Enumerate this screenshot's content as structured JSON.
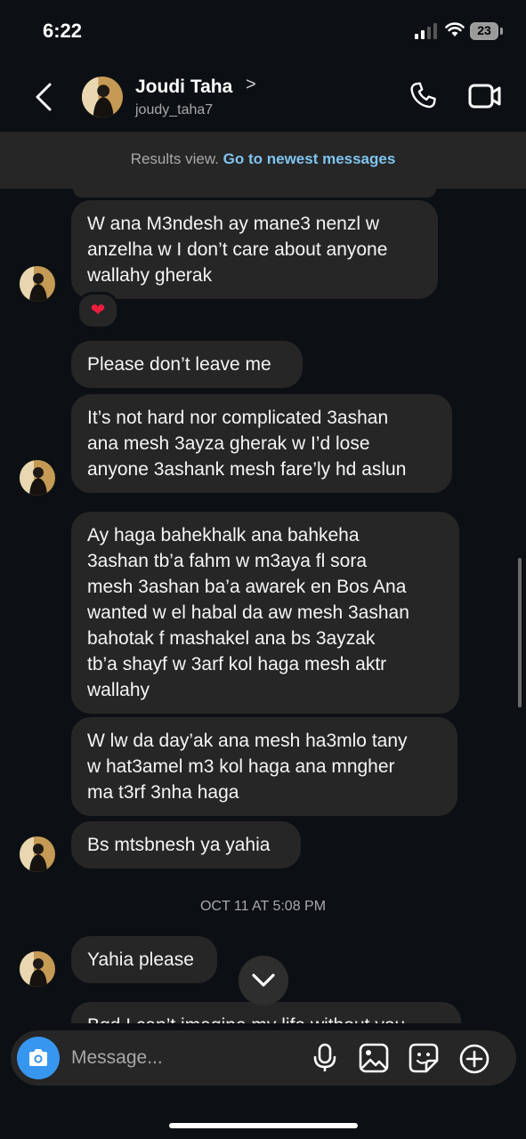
{
  "status_bar": {
    "time": "6:22",
    "battery": "23"
  },
  "header": {
    "contact_name": "Joudi Taha",
    "chevron": ">",
    "username": "joudy_taha7",
    "icons": [
      "back-icon",
      "phone-icon",
      "video-icon"
    ]
  },
  "banner": {
    "prefix": "Results view.",
    "link": "Go to newest messages"
  },
  "messages": [
    {
      "text": "W ana M3ndesh ay mane3 nenzl w\nanzelha w I don’t care about anyone\nwallahy gherak",
      "reaction": "❤"
    },
    {
      "text": "Please don’t leave me"
    },
    {
      "text": "It’s not hard nor complicated 3ashan\nana mesh 3ayza gherak w I’d lose\nanyone 3ashank mesh fare’ly hd aslun"
    },
    {
      "text": "Ay haga bahekhalk ana bahkeha\n3ashan tb’a fahm w m3aya fl sora\nmesh 3ashan ba’a awarek en Bos Ana\nwanted w el habal da aw mesh 3ashan\nbahotak f mashakel ana bs 3ayzak\ntb’a shayf w 3arf kol haga mesh aktr\nwallahy"
    },
    {
      "text": "W lw da day’ak ana mesh ha3mlo tany\nw hat3amel m3 kol haga ana mngher\nma t3rf 3nha haga"
    },
    {
      "text": "Bs mtsbnesh ya yahia"
    },
    {
      "text": "Yahia please"
    },
    {
      "text": "Bgd I can’t imagine my life without you"
    }
  ],
  "timestamp": "OCT 11 AT 5:08 PM",
  "composer": {
    "placeholder": "Message..."
  },
  "colors": {
    "background": "#0c1014",
    "bubble": "#262626",
    "accent": "#3797f0",
    "link": "#7fc4f0"
  }
}
